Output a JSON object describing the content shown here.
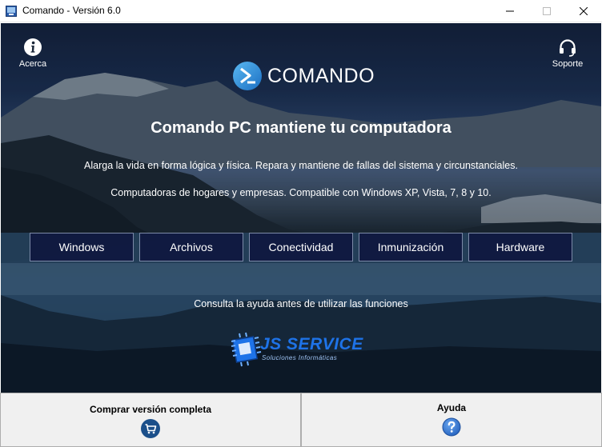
{
  "window": {
    "title": "Comando - Versión 6.0",
    "controls": [
      "minimize-icon",
      "maximize-icon",
      "close-icon"
    ]
  },
  "top_links": {
    "about": {
      "label": "Acerca",
      "icon": "info-icon"
    },
    "support": {
      "label": "Soporte",
      "icon": "headset-icon"
    }
  },
  "logo": {
    "name": "COMANDO",
    "icon": "terminal-prompt-icon"
  },
  "hero": {
    "headline": "Comando PC mantiene tu computadora",
    "line1": "Alarga la vida en forma lógica y física. Repara y mantiene de fallas del sistema y circunstanciales.",
    "line2": "Computadoras de hogares y empresas. Compatible con Windows XP, Vista, 7, 8 y 10."
  },
  "nav_buttons": [
    "Windows",
    "Archivos",
    "Conectividad",
    "Inmunización",
    "Hardware"
  ],
  "hint": "Consulta la ayuda antes de utilizar las funciones",
  "brand": {
    "title": "JS SERVICE",
    "subtitle": "Soluciones Informáticas",
    "icon": "chip-icon"
  },
  "bottom": {
    "buy": {
      "label": "Comprar versión completa",
      "icon": "cart-icon"
    },
    "help": {
      "label": "Ayuda",
      "icon": "question-icon"
    }
  },
  "colors": {
    "accent": "#1e73e8",
    "button_bg": "#0e163e",
    "icon_dark_blue": "#1b4f8a",
    "help_blue": "#3a7bd5"
  }
}
